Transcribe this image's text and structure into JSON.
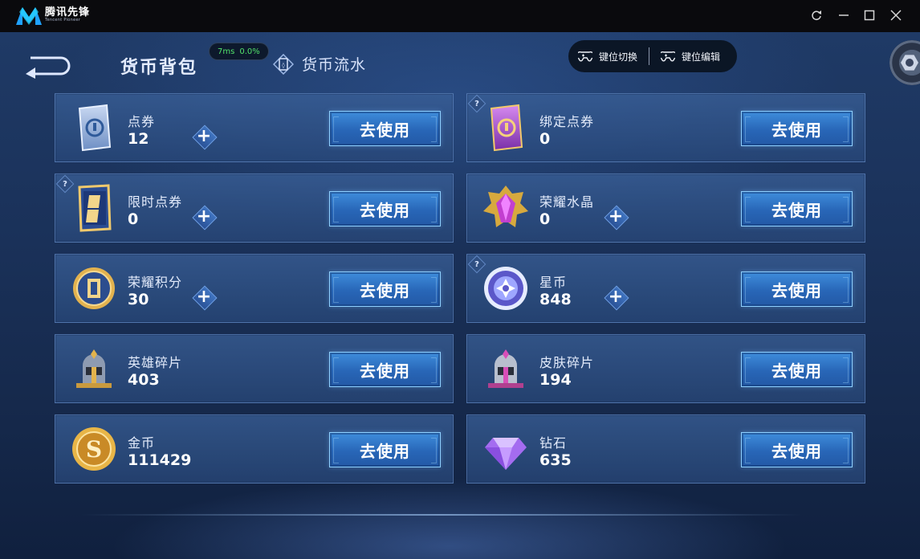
{
  "app": {
    "name_cn": "腾讯先锋",
    "name_en": "Tencent Pioneer"
  },
  "window_controls": [
    "refresh-icon",
    "minimize-icon",
    "maximize-icon",
    "close-icon"
  ],
  "header": {
    "title": "货币背包",
    "ping": "7ms",
    "loss": "0.0%",
    "flow_tab": "货币流水"
  },
  "keymap": {
    "switch_label": "键位切换",
    "edit_label": "键位编辑"
  },
  "colors": {
    "ping_green": "#52e16b",
    "button_blue": "#2866b7",
    "card_bg": "#30558f"
  },
  "currencies": [
    {
      "name": "点券",
      "amount": "12",
      "icon": "coupon-card-icon",
      "plus": true,
      "help": false
    },
    {
      "name": "绑定点券",
      "amount": "0",
      "icon": "bound-coupon-card-icon",
      "plus": false,
      "help": true
    },
    {
      "name": "限时点券",
      "amount": "0",
      "icon": "limited-coupon-icon",
      "plus": true,
      "help": true
    },
    {
      "name": "荣耀水晶",
      "amount": "0",
      "icon": "glory-crystal-icon",
      "plus": true,
      "help": false
    },
    {
      "name": "荣耀积分",
      "amount": "30",
      "icon": "glory-points-icon",
      "plus": true,
      "help": false
    },
    {
      "name": "星币",
      "amount": "848",
      "icon": "star-coin-icon",
      "plus": true,
      "help": true
    },
    {
      "name": "英雄碎片",
      "amount": "403",
      "icon": "hero-fragment-icon",
      "plus": false,
      "help": false
    },
    {
      "name": "皮肤碎片",
      "amount": "194",
      "icon": "skin-fragment-icon",
      "plus": false,
      "help": false
    },
    {
      "name": "金币",
      "amount": "111429",
      "icon": "gold-coin-icon",
      "plus": false,
      "help": false
    },
    {
      "name": "钻石",
      "amount": "635",
      "icon": "diamond-icon",
      "plus": false,
      "help": false
    }
  ],
  "use_button_label": "去使用",
  "plus_symbol": "+",
  "help_symbol": "?"
}
